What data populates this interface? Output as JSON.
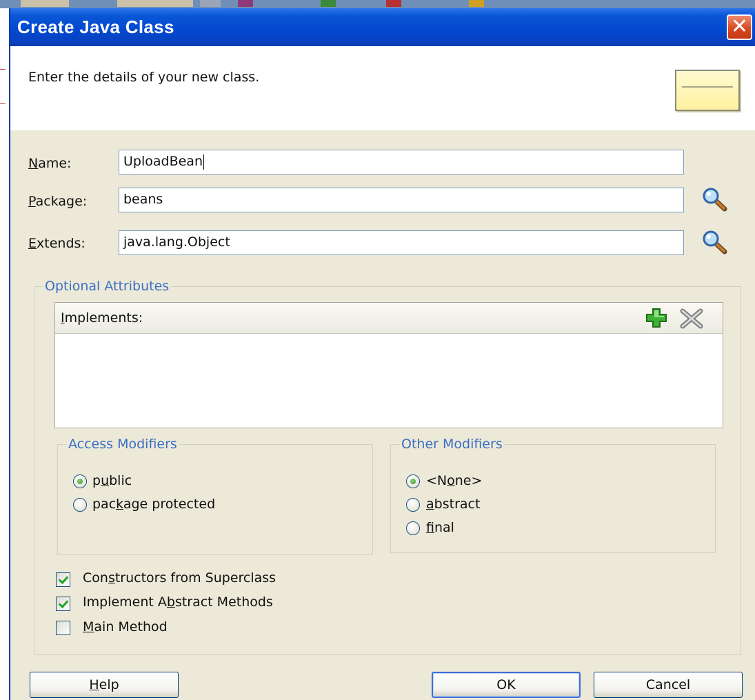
{
  "window": {
    "title": "Create Java Class",
    "close_glyph": "✕"
  },
  "header": {
    "description": "Enter the details of your new class.",
    "icon": "note-icon"
  },
  "form": {
    "name": {
      "label_mn": "N",
      "label_rest": "ame:",
      "value": "UploadBean"
    },
    "package": {
      "label_mn": "P",
      "label_rest": "ackage:",
      "value": "beans"
    },
    "extends": {
      "label_mn": "E",
      "label_rest": "xtends:",
      "value": "java.lang.Object"
    }
  },
  "optional": {
    "legend": "Optional Attributes",
    "implements_mn": "I",
    "implements_rest": "mplements:",
    "access": {
      "legend": "Access Modifiers",
      "options": [
        {
          "pre": "p",
          "mn": "u",
          "post": "blic",
          "selected": true
        },
        {
          "pre": "pac",
          "mn": "k",
          "post": "age protected",
          "selected": false
        }
      ]
    },
    "other": {
      "legend": "Other Modifiers",
      "options": [
        {
          "pre": "<N",
          "mn": "o",
          "post": "ne>",
          "selected": true
        },
        {
          "pre": "",
          "mn": "a",
          "post": "bstract",
          "selected": false
        },
        {
          "pre": "",
          "mn": "f",
          "post": "inal",
          "selected": false
        }
      ]
    },
    "checks": [
      {
        "pre": "Con",
        "mn": "s",
        "post": "tructors from Superclass",
        "checked": true
      },
      {
        "pre": "Implement A",
        "mn": "b",
        "post": "stract Methods",
        "checked": true
      },
      {
        "pre": "",
        "mn": "M",
        "post": "ain Method",
        "checked": false
      }
    ]
  },
  "buttons": {
    "help": {
      "mn": "H",
      "rest": "elp"
    },
    "ok": "OK",
    "cancel": "Cancel"
  },
  "colors": {
    "title_bar": "#0349d0",
    "legend": "#3a6fc4",
    "dialog_bg": "#ece9d8"
  }
}
